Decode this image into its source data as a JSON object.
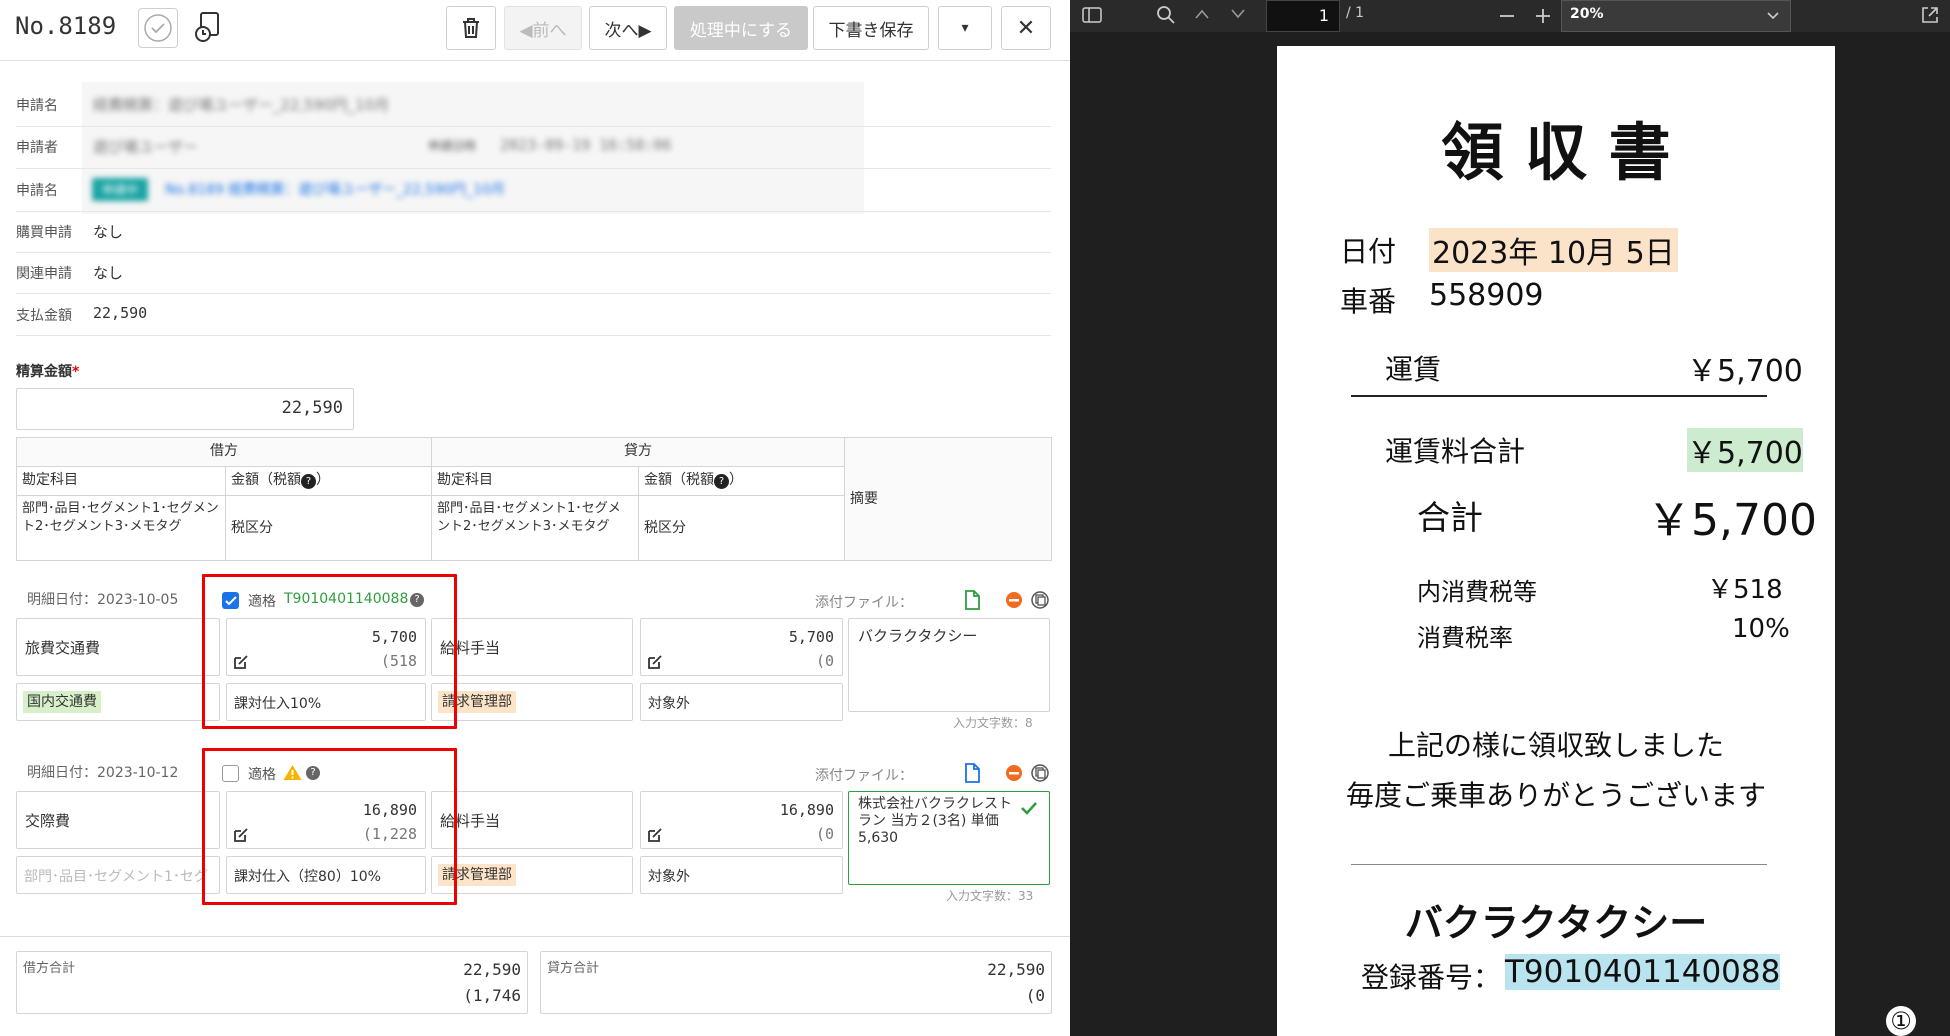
{
  "header": {
    "doc_number": "No.8189",
    "prev_label": "◀前へ",
    "next_label": "次へ▶",
    "process_label": "処理中にする",
    "draft_label": "下書き保存",
    "dropdown_glyph": "▾",
    "close_glyph": "✕"
  },
  "info": {
    "app_name_label": "申請名",
    "app_name_value": "経費精算：遊び場ユーザー_22,590円_10月",
    "applicant_label": "申請者",
    "applicant_value": "遊び場ユーザー",
    "applied_date_label": "申請日時",
    "applied_date_value": "2023-09-19 16:58:06",
    "app_name2_label": "申請名",
    "status_badge": "申請中",
    "app_link": "No.8189 経費精算：遊び場ユーザー_22,590円_10月",
    "purchase_label": "購買申請",
    "purchase_value": "なし",
    "related_label": "関連申請",
    "related_value": "なし",
    "payment_label": "支払金額",
    "payment_value": "22,590"
  },
  "settlement": {
    "label": "精算金額",
    "required_mark": "*",
    "amount": "22,590"
  },
  "journal_header": {
    "debit": "借方",
    "credit": "貸方",
    "account": "勘定科目",
    "amount_tax": "金額（税額",
    "help": "?",
    "close_paren": "）",
    "segments": "部門･品目･セグメント1･セグメント2･セグメント3･メモタグ",
    "tax_category": "税区分",
    "summary": "摘要"
  },
  "lines": [
    {
      "date_label": "明細日付：2023-10-05",
      "qualified_label": "適格",
      "reg_number": "T9010401140088",
      "attach_label": "添付ファイル：",
      "debit_account": "旅費交通費",
      "debit_amount": "5,700",
      "debit_tax": "(518",
      "credit_account": "給料手当",
      "credit_amount": "5,700",
      "credit_tax": "(0",
      "memo": "バクラクタクシー",
      "debit_tag": "国内交通費",
      "debit_tax_cat": "課対仕入10%",
      "credit_tag": "請求管理部",
      "credit_tax_cat": "対象外",
      "char_count": "入力文字数：8"
    },
    {
      "date_label": "明細日付：2023-10-12",
      "qualified_label": "適格",
      "attach_label": "添付ファイル：",
      "debit_account": "交際費",
      "debit_amount": "16,890",
      "debit_tax": "(1,228",
      "credit_account": "給料手当",
      "credit_amount": "16,890",
      "credit_tax": "(0",
      "memo": "株式会社バクラクレストラン 当方２(3名) 単価 5,630",
      "debit_segment_placeholder": "部門･品目･セグメント1･セグ",
      "debit_tax_cat": "課対仕入（控80）10%",
      "credit_tag": "請求管理部",
      "credit_tax_cat": "対象外",
      "char_count": "入力文字数：33"
    }
  ],
  "totals": {
    "debit_label": "借方合計",
    "debit_amount": "22,590",
    "debit_tax": "(1,746",
    "credit_label": "貸方合計",
    "credit_amount": "22,590",
    "credit_tax": "(0"
  },
  "viewer": {
    "page_current": "1",
    "page_total": "/ 1",
    "zoom": "20%",
    "page_badge": "①"
  },
  "receipt": {
    "title": "領 収 書",
    "date_label": "日付",
    "date_value": "2023年 10月 5日",
    "car_label": "車番",
    "car_value": "558909",
    "fare_label": "運賃",
    "fare_value": "￥5,700",
    "fare_total_label": "運賃料合計",
    "fare_total_value": "￥5,700",
    "total_label": "合計",
    "total_value": "￥5,700",
    "tax_label": "内消費税等",
    "tax_value": "￥518",
    "tax_rate_label": "消費税率",
    "tax_rate_value": "10%",
    "message1": "上記の様に領収致しました",
    "message2": "毎度ご乗車ありがとうございます",
    "company": "バクラクタクシー",
    "reg_label": "登録番号：",
    "reg_value": "T9010401140088"
  },
  "colors": {
    "accent_green": "#2e9e3e",
    "highlight_box": "#e00000",
    "badge_teal": "#1aa3a3",
    "link_blue": "#1a73e8",
    "tag_green_bg": "#d7f0c9",
    "tag_orange_bg": "#fde4c8",
    "receipt_date_bg": "#fbe3c9",
    "receipt_amount_bg": "#cdeccf",
    "receipt_reg_bg": "#b9e3ee"
  }
}
